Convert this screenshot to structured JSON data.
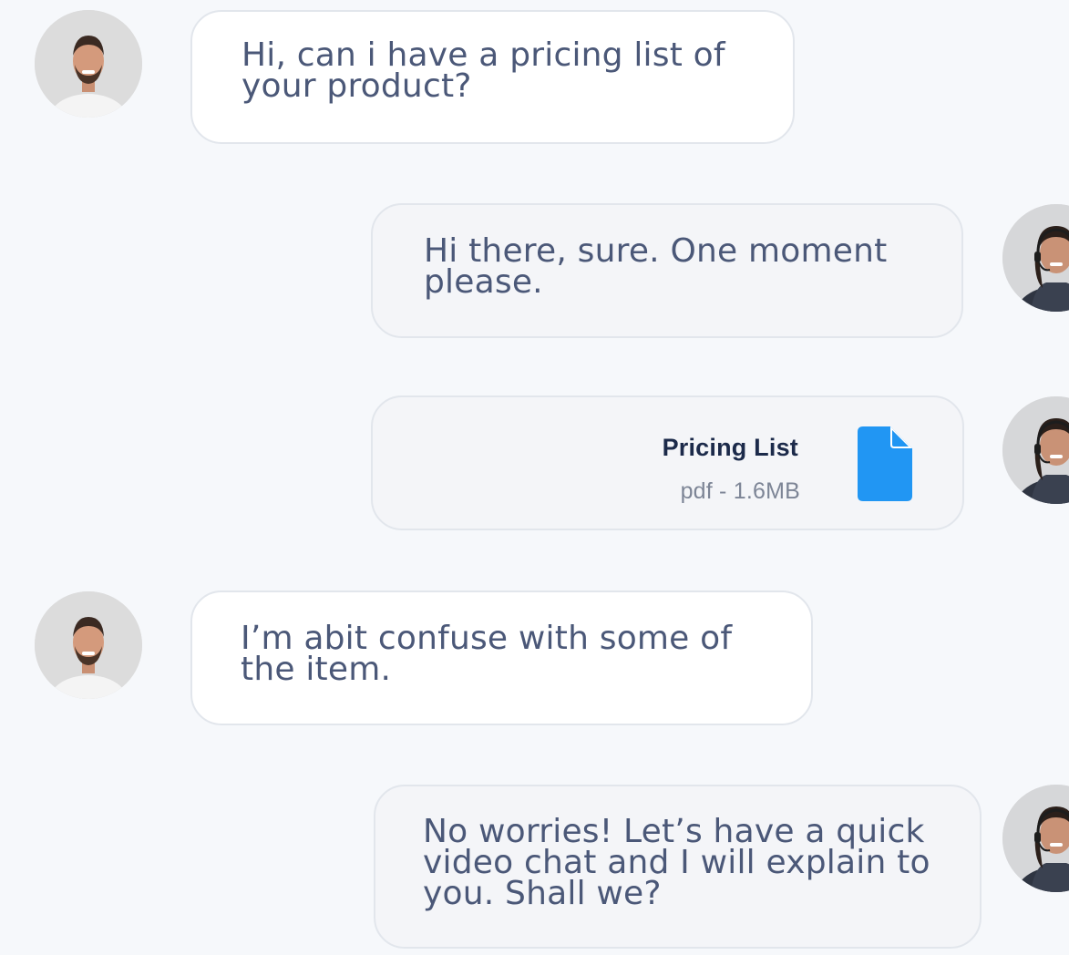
{
  "conversation": {
    "messages": [
      {
        "sender": "customer",
        "text": "Hi, can i have a pricing list of\nyour product?"
      },
      {
        "sender": "agent",
        "text": "Hi there, sure. One moment\nplease."
      },
      {
        "sender": "agent",
        "type": "file",
        "file_name": "Pricing List",
        "file_meta": "pdf - 1.6MB"
      },
      {
        "sender": "customer",
        "text": "I’m abit confuse with some of\nthe item."
      },
      {
        "sender": "agent",
        "text": "No worries! Let’s have a quick\nvideo chat and I will explain to\nyou. Shall we?"
      }
    ]
  },
  "colors": {
    "page_background": "#f6f8fb",
    "customer_bubble": "#ffffff",
    "agent_bubble": "#f4f5f8",
    "text": "#4b5878",
    "file_icon": "#2196f3"
  },
  "icons": {
    "file": "file-icon"
  }
}
